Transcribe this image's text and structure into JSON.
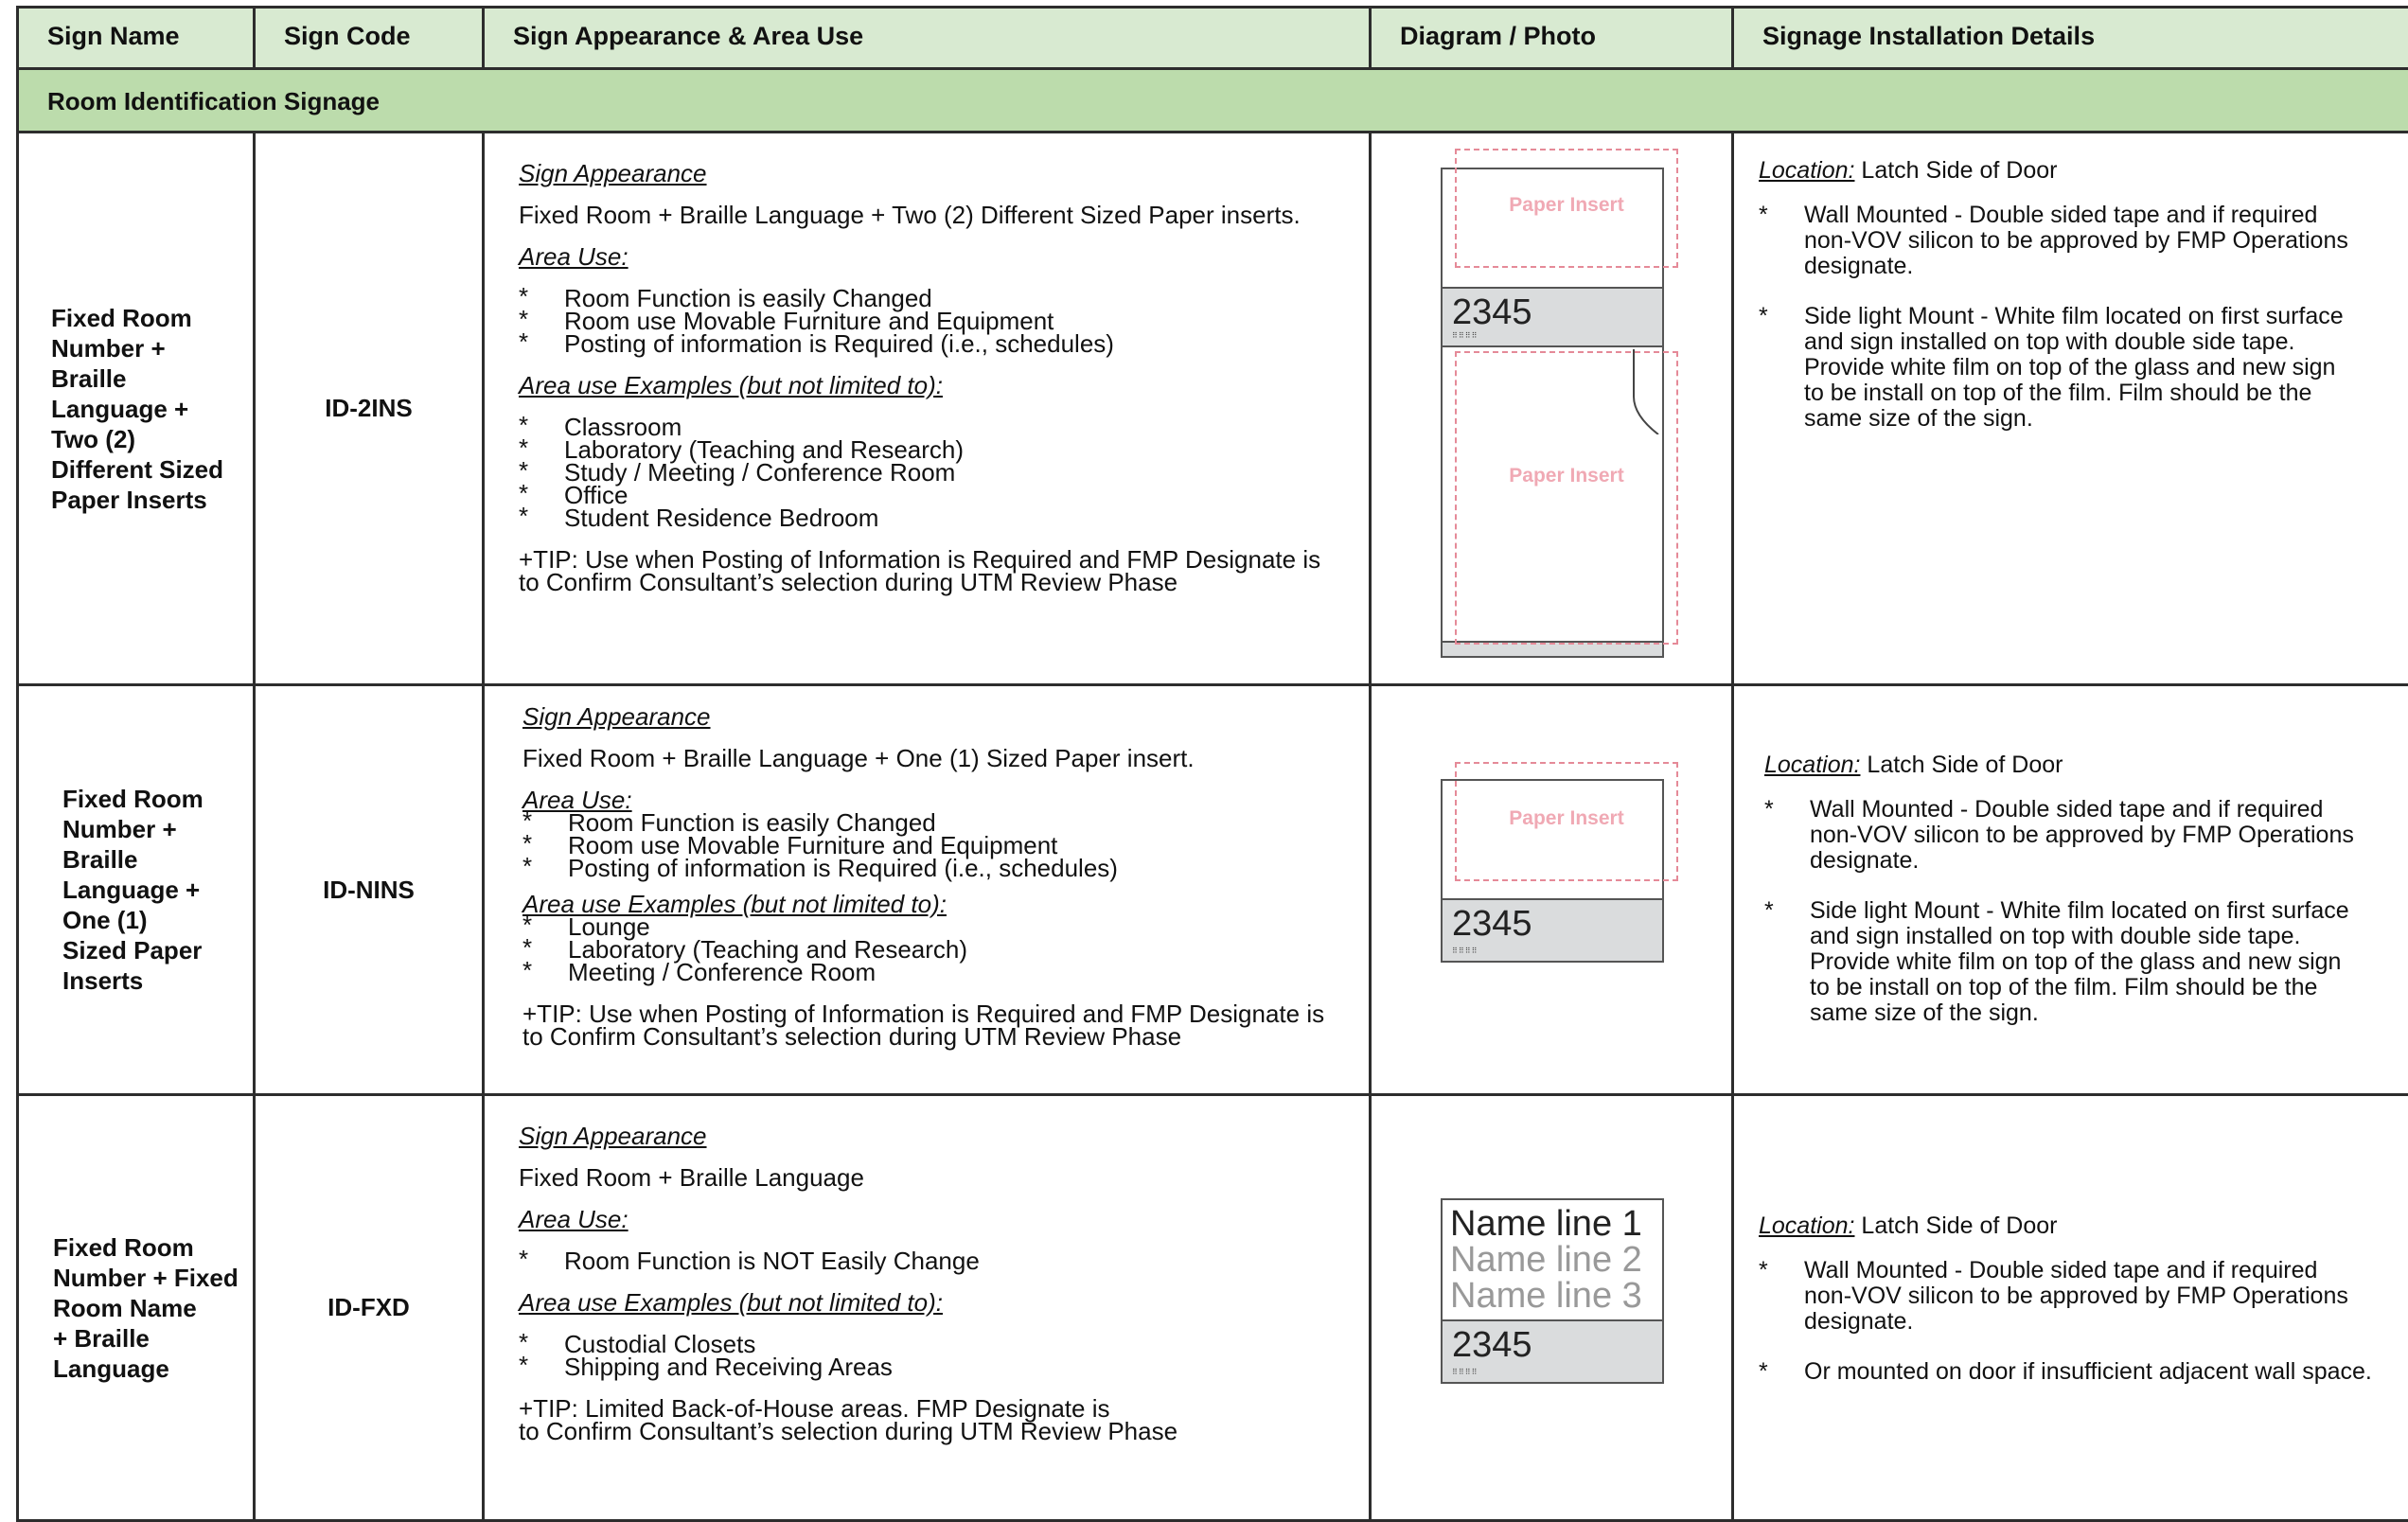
{
  "headers": {
    "sign_name": "Sign Name",
    "sign_code": "Sign Code",
    "appearance": "Sign Appearance & Area Use",
    "diagram": "Diagram / Photo",
    "details": "Signage Installation Details"
  },
  "section": "Room Identification Signage",
  "rows": [
    {
      "name_lines": [
        "Fixed Room",
        "Number +",
        "Braille",
        "Language +",
        "Two (2)",
        "Different Sized",
        "Paper Inserts"
      ],
      "code": "ID-2INS",
      "appearance_label": "Sign Appearance",
      "appearance": "Fixed Room + Braille Language + Two (2) Different Sized Paper inserts.",
      "area_use_label": "Area Use:",
      "area_use": [
        "Room Function is easily Changed",
        "Room use Movable Furniture and Equipment",
        "Posting of information is Required (i.e., schedules)"
      ],
      "examples_label": "Area use Examples (but not limited to):",
      "examples": [
        "Classroom",
        "Laboratory (Teaching and Research)",
        "Study / Meeting / Conference Room",
        "Office",
        "Student Residence Bedroom"
      ],
      "tip_lines": [
        "+TIP: Use when Posting of Information is Required and FMP Designate is",
        "to Confirm Consultant’s selection during UTM Review Phase"
      ],
      "diagram": {
        "insert_label": "Paper Insert",
        "number": "2345",
        "braille": "⠿⠿⠿⠿"
      },
      "location_label": "Location:",
      "location": " Latch Side of Door",
      "details": [
        [
          "Wall Mounted - Double sided tape and if required",
          "non-VOV silicon to be approved by FMP Operations",
          "designate."
        ],
        [
          "Side light Mount - White film located on first surface",
          "and sign installed on top with double side tape.",
          "Provide white film on top of the glass and new sign",
          "to be install on top of the film. Film should be the",
          "same size of the sign."
        ]
      ]
    },
    {
      "name_lines": [
        "Fixed Room",
        "Number +",
        "Braille",
        "Language +",
        "One (1)",
        "Sized Paper",
        "Inserts"
      ],
      "code": "ID-NINS",
      "appearance_label": "Sign Appearance",
      "appearance": "Fixed Room + Braille Language + One (1) Sized Paper insert.",
      "area_use_label": "Area Use:",
      "area_use": [
        "Room Function is easily Changed",
        "Room use Movable Furniture and Equipment",
        "Posting of information is Required (i.e., schedules)"
      ],
      "examples_label": "Area use Examples (but not limited to):",
      "examples": [
        "Lounge",
        "Laboratory (Teaching and Research)",
        "Meeting / Conference Room"
      ],
      "tip_lines": [
        "+TIP: Use when Posting of Information is Required and FMP Designate is",
        "to Confirm Consultant’s selection during UTM Review Phase"
      ],
      "diagram": {
        "insert_label": "Paper Insert",
        "number": "2345",
        "braille": "⠿⠿⠿⠿"
      },
      "location_label": "Location:",
      "location": " Latch Side of Door",
      "details": [
        [
          "Wall Mounted - Double sided tape and if required",
          "non-VOV silicon to be approved by FMP Operations",
          "designate."
        ],
        [
          "Side light Mount - White film located on first surface",
          "and sign installed on top with double side tape.",
          "Provide white film on top of the glass and new sign",
          "to be install on top of the film. Film should be the",
          "same size of the sign."
        ]
      ]
    },
    {
      "name_lines": [
        "Fixed Room",
        "Number + Fixed",
        "Room Name",
        "+ Braille",
        "Language"
      ],
      "code": "ID-FXD",
      "appearance_label": "Sign Appearance",
      "appearance": "Fixed Room + Braille Language",
      "area_use_label": "Area Use:",
      "area_use": [
        "Room Function is NOT Easily Change"
      ],
      "examples_label": "Area use Examples (but not limited to):",
      "examples": [
        "Custodial Closets",
        "Shipping and Receiving Areas"
      ],
      "tip_lines": [
        "+TIP: Limited Back-of-House areas. FMP Designate is",
        "to Confirm Consultant’s selection during UTM Review Phase"
      ],
      "diagram": {
        "name_lines": [
          "Name line 1",
          "Name line 2",
          "Name line 3"
        ],
        "number": "2345",
        "braille": "⠿⠿⠿⠿"
      },
      "location_label": "Location:",
      "location": " Latch Side of Door",
      "details": [
        [
          "Wall Mounted - Double sided tape and if required",
          "non-VOV silicon to be approved by FMP Operations",
          "designate."
        ],
        [
          "Or mounted on door if insufficient adjacent wall space."
        ]
      ]
    }
  ]
}
